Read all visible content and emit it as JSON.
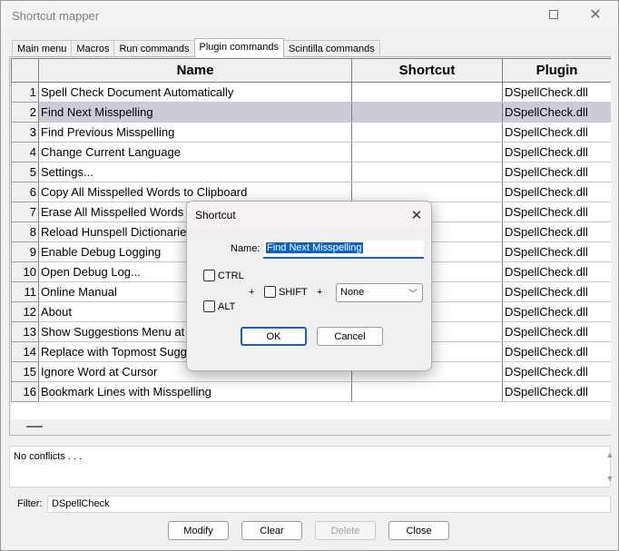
{
  "window": {
    "title": "Shortcut mapper"
  },
  "tabs": [
    "Main menu",
    "Macros",
    "Run commands",
    "Plugin commands",
    "Scintilla commands"
  ],
  "grid": {
    "columns": [
      "Name",
      "Shortcut",
      "Plugin"
    ],
    "rows": [
      {
        "num": "1",
        "name": "Spell Check Document Automatically",
        "shortcut": "",
        "plugin": "DSpellCheck.dll"
      },
      {
        "num": "2",
        "name": "Find Next Misspelling",
        "shortcut": "",
        "plugin": "DSpellCheck.dll"
      },
      {
        "num": "3",
        "name": "Find Previous Misspelling",
        "shortcut": "",
        "plugin": "DSpellCheck.dll"
      },
      {
        "num": "4",
        "name": "Change Current Language",
        "shortcut": "",
        "plugin": "DSpellCheck.dll"
      },
      {
        "num": "5",
        "name": "Settings...",
        "shortcut": "",
        "plugin": "DSpellCheck.dll"
      },
      {
        "num": "6",
        "name": "Copy All Misspelled Words to Clipboard",
        "shortcut": "",
        "plugin": "DSpellCheck.dll"
      },
      {
        "num": "7",
        "name": "Erase All Misspelled Words",
        "shortcut": "",
        "plugin": "DSpellCheck.dll"
      },
      {
        "num": "8",
        "name": "Reload Hunspell Dictionaries",
        "shortcut": "",
        "plugin": "DSpellCheck.dll"
      },
      {
        "num": "9",
        "name": "Enable Debug Logging",
        "shortcut": "",
        "plugin": "DSpellCheck.dll"
      },
      {
        "num": "10",
        "name": "Open Debug Log...",
        "shortcut": "",
        "plugin": "DSpellCheck.dll"
      },
      {
        "num": "11",
        "name": "Online Manual",
        "shortcut": "",
        "plugin": "DSpellCheck.dll"
      },
      {
        "num": "12",
        "name": "About",
        "shortcut": "",
        "plugin": "DSpellCheck.dll"
      },
      {
        "num": "13",
        "name": "Show Suggestions Menu at",
        "shortcut": "",
        "plugin": "DSpellCheck.dll"
      },
      {
        "num": "14",
        "name": "Replace with Topmost Sugg",
        "shortcut": "",
        "plugin": "DSpellCheck.dll"
      },
      {
        "num": "15",
        "name": "Ignore Word at Cursor",
        "shortcut": "",
        "plugin": "DSpellCheck.dll"
      },
      {
        "num": "16",
        "name": "Bookmark Lines with Misspelling",
        "shortcut": "",
        "plugin": "DSpellCheck.dll"
      }
    ]
  },
  "conflicts": {
    "text": "No conflicts . . ."
  },
  "filter": {
    "label": "Filter:",
    "value": "DSpellCheck"
  },
  "buttons": {
    "modify": "Modify",
    "clear": "Clear",
    "delete": "Delete",
    "close": "Close"
  },
  "dialog": {
    "title": "Shortcut",
    "name_label": "Name:",
    "name_value": "Find Next Misspelling",
    "ctrl_label": "CTRL",
    "alt_label": "ALT",
    "shift_label": "SHIFT",
    "plus1": "+",
    "plus2": "+",
    "key_value": "None",
    "ok_label": "OK",
    "cancel_label": "Cancel"
  }
}
